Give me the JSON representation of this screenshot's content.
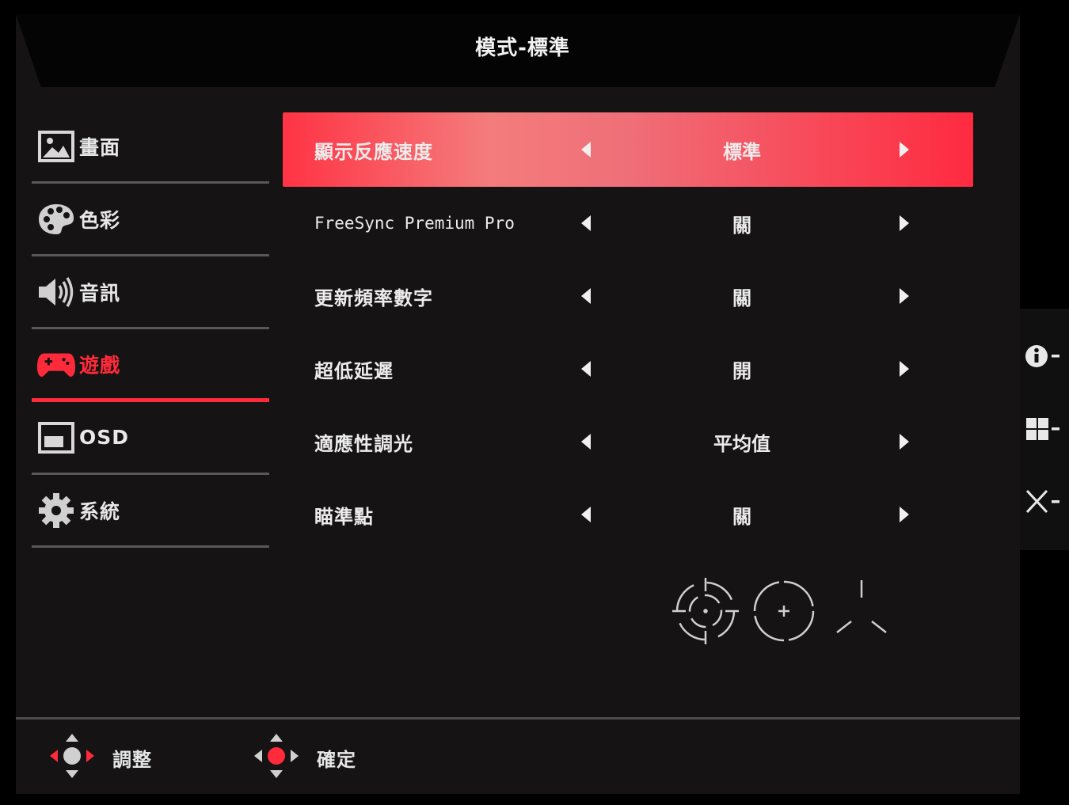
{
  "header": {
    "title": "模式-標準"
  },
  "sidebar": {
    "items": [
      {
        "label": "畫面",
        "icon": "picture-icon",
        "active": false
      },
      {
        "label": "色彩",
        "icon": "palette-icon",
        "active": false
      },
      {
        "label": "音訊",
        "icon": "speaker-icon",
        "active": false
      },
      {
        "label": "遊戲",
        "icon": "gamepad-icon",
        "active": true
      },
      {
        "label": "OSD",
        "icon": "osd-window-icon",
        "active": false
      },
      {
        "label": "系統",
        "icon": "gear-icon",
        "active": false
      }
    ]
  },
  "settings": {
    "rows": [
      {
        "label": "顯示反應速度",
        "value": "標準",
        "selected": true
      },
      {
        "label": "FreeSync Premium Pro",
        "value": "關",
        "selected": false
      },
      {
        "label": "更新頻率數字",
        "value": "關",
        "selected": false
      },
      {
        "label": "超低延遲",
        "value": "開",
        "selected": false
      },
      {
        "label": "適應性調光",
        "value": "平均值",
        "selected": false
      },
      {
        "label": "瞄準點",
        "value": "關",
        "selected": false
      }
    ]
  },
  "crosshair_options": [
    "crosshair-ring-icon",
    "crosshair-circle-icon",
    "crosshair-tri-icon"
  ],
  "right_panel": {
    "buttons": [
      {
        "icon": "info-icon"
      },
      {
        "icon": "windows-icon"
      },
      {
        "icon": "close-icon"
      }
    ]
  },
  "footer": {
    "adjust_label": "調整",
    "confirm_label": "確定"
  },
  "colors": {
    "accent": "#ff2a3a",
    "background": "#151313",
    "text": "#ececec"
  }
}
